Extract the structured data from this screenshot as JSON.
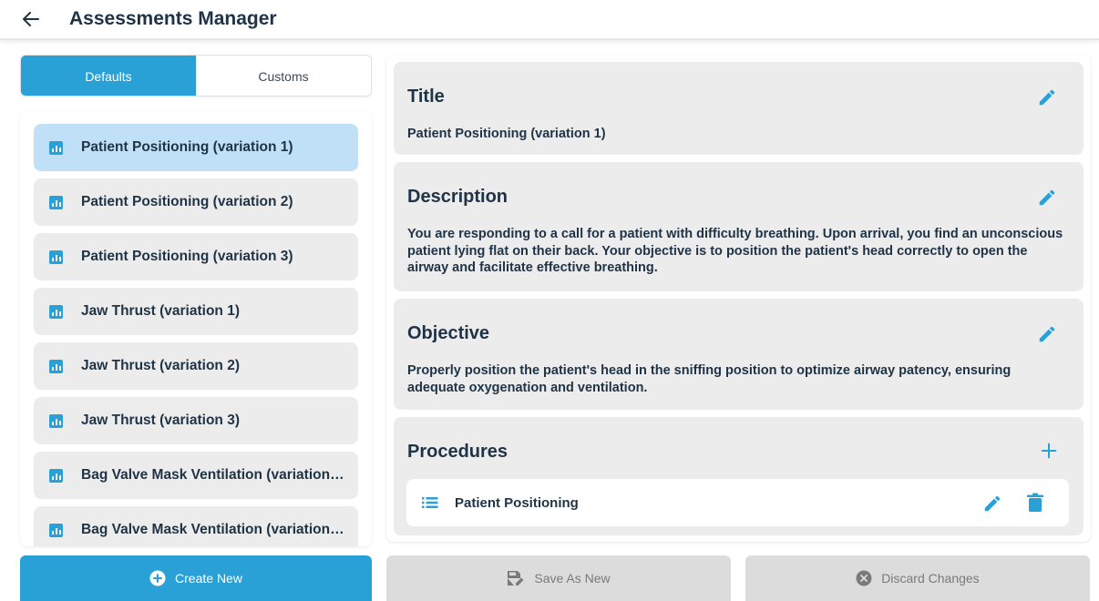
{
  "header": {
    "title": "Assessments Manager",
    "back_icon": "arrow-left-icon"
  },
  "tabs": [
    {
      "label": "Defaults",
      "active": true
    },
    {
      "label": "Customs",
      "active": false
    }
  ],
  "assessments": [
    {
      "label": "Patient Positioning (variation 1)",
      "selected": true
    },
    {
      "label": "Patient Positioning (variation 2)",
      "selected": false
    },
    {
      "label": "Patient Positioning (variation 3)",
      "selected": false
    },
    {
      "label": "Jaw Thrust (variation 1)",
      "selected": false
    },
    {
      "label": "Jaw Thrust (variation 2)",
      "selected": false
    },
    {
      "label": "Jaw Thrust (variation 3)",
      "selected": false
    },
    {
      "label": "Bag Valve Mask Ventilation (variation…",
      "selected": false
    },
    {
      "label": "Bag Valve Mask Ventilation (variation…",
      "selected": false
    }
  ],
  "details": {
    "title": {
      "heading": "Title",
      "value": "Patient Positioning (variation 1)"
    },
    "description": {
      "heading": "Description",
      "value": "You are responding to a call for a patient with difficulty breathing. Upon arrival, you find an unconscious patient lying flat on their back. Your objective is to position the patient's head correctly to open the airway and facilitate effective breathing."
    },
    "objective": {
      "heading": "Objective",
      "value": "Properly position the patient's head in the sniffing position to optimize airway patency, ensuring adequate oxygenation and ventilation."
    },
    "procedures": {
      "heading": "Procedures",
      "items": [
        {
          "label": "Patient Positioning"
        }
      ]
    }
  },
  "actions": {
    "create_label": "Create New",
    "save_label": "Save As New",
    "discard_label": "Discard Changes"
  },
  "colors": {
    "accent": "#2aa1d6",
    "text": "#1f3346",
    "card": "#ececec",
    "selected": "#bfe0f6",
    "disabled": "#dcdcdc"
  }
}
